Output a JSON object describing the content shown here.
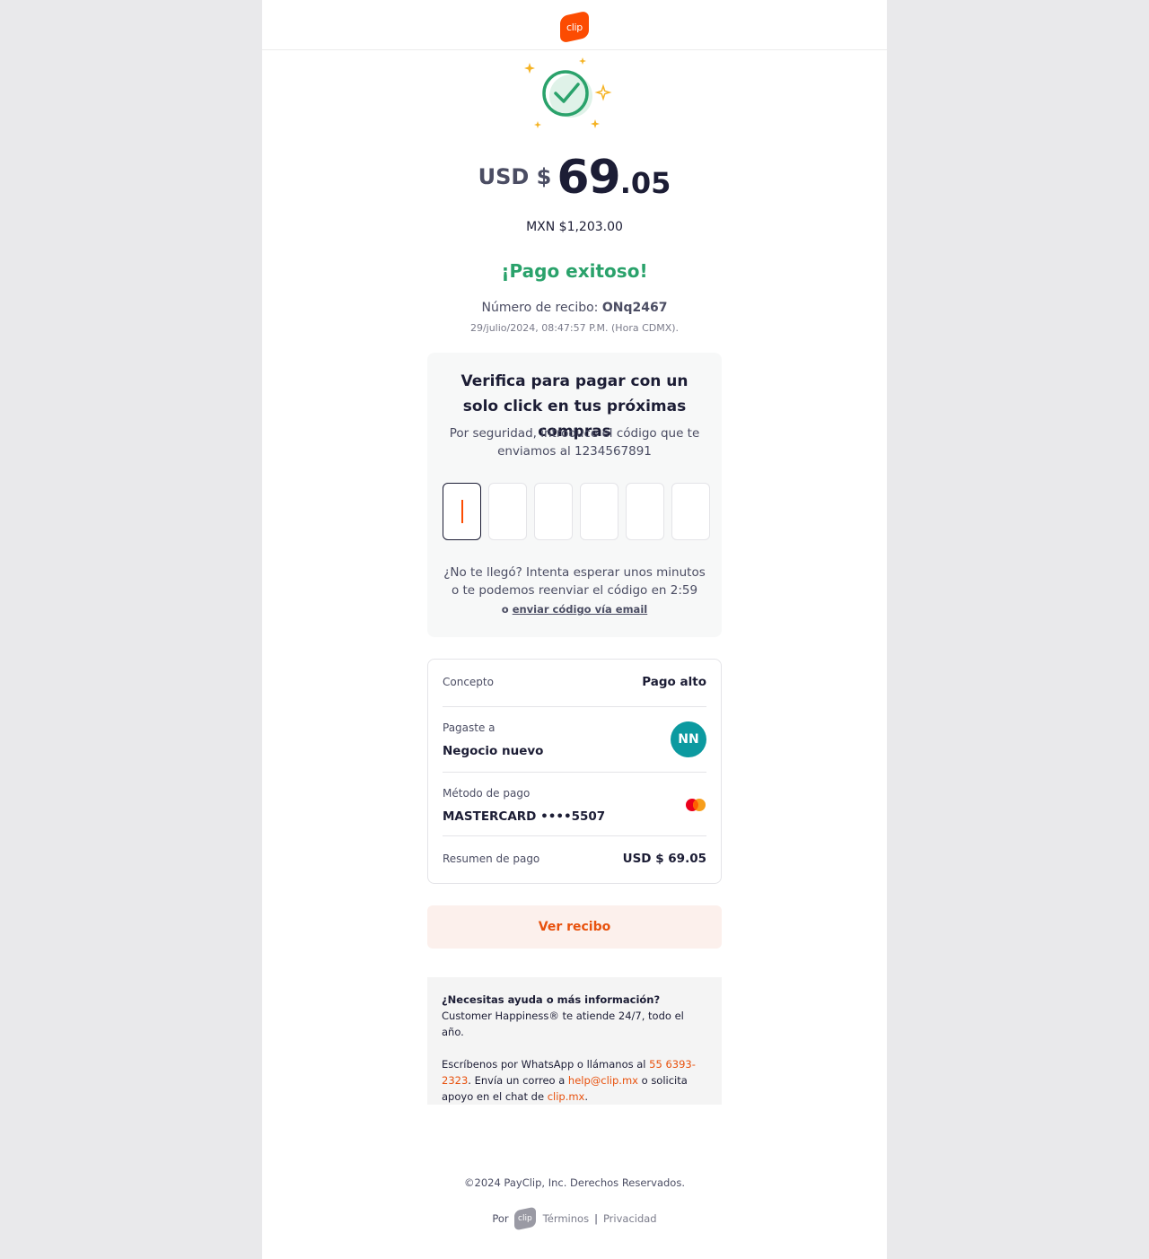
{
  "header": {
    "logo_text": "clip"
  },
  "icons": {
    "success": "check-circle-sparkles-icon",
    "card": "mastercard-icon"
  },
  "amount": {
    "currency": "USD $",
    "integer": "69",
    "decimals": ".05",
    "mxn": "MXN $1,203.00"
  },
  "status": {
    "title": "¡Pago exitoso!"
  },
  "receipt": {
    "label": "Número de recibo:",
    "number": "ONq2467",
    "datetime": "29/julio/2024, 08:47:57 P.M. (Hora CDMX)."
  },
  "verify": {
    "title": "Verifica para pagar con un solo click en tus próximas compras",
    "subtitle": "Por seguridad, introduce el código que te enviamos al 1234567891",
    "resend": "¿No te llegó? Intenta esperar unos minutos o te podemos reenviar el código en 2:59",
    "email_prefix": "o",
    "email_link": "enviar código vía email"
  },
  "details": {
    "concept_label": "Concepto",
    "concept_value": "Pago alto",
    "paid_to_label": "Pagaste a",
    "paid_to_value": "Negocio nuevo",
    "avatar_initials": "NN",
    "method_label": "Método de pago",
    "method_value": "MASTERCARD ••••5507",
    "summary_label": "Resumen de pago",
    "summary_value": "USD $ 69.05"
  },
  "button": {
    "view_receipt": "Ver recibo"
  },
  "help": {
    "heading": "¿Necesitas ayuda o más información?",
    "line1": "Customer Happiness® te atiende 24/7, todo el año.",
    "p2_a": "Escríbenos por WhatsApp o llámanos al ",
    "phone": "55 6393-2323",
    "p2_b": ". Envía un correo a ",
    "email": "help@clip.mx",
    "p2_c": " o solicita apoyo en el chat de ",
    "site": "clip.mx",
    "p2_d": "."
  },
  "footer": {
    "copyright": "©2024 PayClip, Inc. Derechos Reservados.",
    "por": "Por",
    "logo_text": "clip",
    "terms": "Términos",
    "separator": "|",
    "privacy": "Privacidad"
  },
  "colors": {
    "brand": "#fc4c02",
    "success": "#2aa26b",
    "avatar": "#0c9aa0"
  }
}
